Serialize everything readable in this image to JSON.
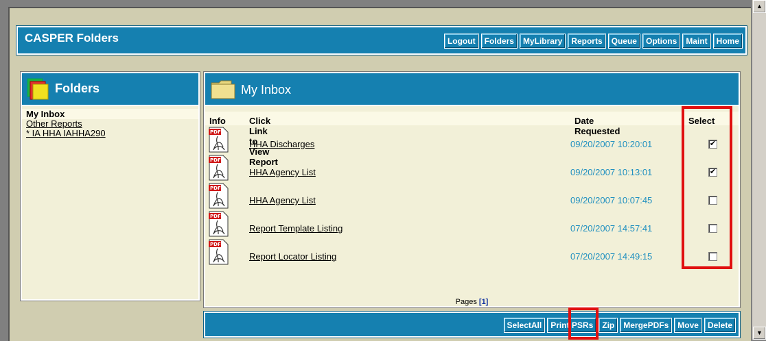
{
  "header": {
    "title": "CASPER Folders",
    "nav": [
      "Logout",
      "Folders",
      "MyLibrary",
      "Reports",
      "Queue",
      "Options",
      "Maint",
      "Home"
    ]
  },
  "folders_panel": {
    "title": "Folders",
    "items": [
      {
        "label": "My Inbox",
        "active": true
      },
      {
        "label": "Other Reports",
        "active": false
      },
      {
        "label": "* IA HHA IAHHA290",
        "active": false
      }
    ]
  },
  "inbox": {
    "title": "My Inbox",
    "columns": {
      "info": "Info",
      "report": "Click Link to View Report",
      "date": "Date Requested",
      "select": "Select"
    },
    "sort_glyph": "↓",
    "pdf_label": "PDF",
    "rows": [
      {
        "report": "HHA Discharges",
        "date": "09/20/2007 10:20:01",
        "checked": true
      },
      {
        "report": "HHA Agency List",
        "date": "09/20/2007 10:13:01",
        "checked": true
      },
      {
        "report": "HHA Agency List",
        "date": "09/20/2007 10:07:45",
        "checked": false
      },
      {
        "report": "Report Template Listing",
        "date": "07/20/2007 14:57:41",
        "checked": false
      },
      {
        "report": "Report Locator Listing",
        "date": "07/20/2007 14:49:15",
        "checked": false
      }
    ],
    "pages_label": "Pages",
    "current_page": "[1]"
  },
  "actions": [
    "SelectAll",
    "Print PSRs",
    "Zip",
    "MergePDFs",
    "Move",
    "Delete"
  ],
  "colors": {
    "panel_blue": "#1580b0",
    "date_blue": "#2090c0",
    "highlight_red": "#e01010",
    "panel_bg": "#f2f0d8"
  }
}
